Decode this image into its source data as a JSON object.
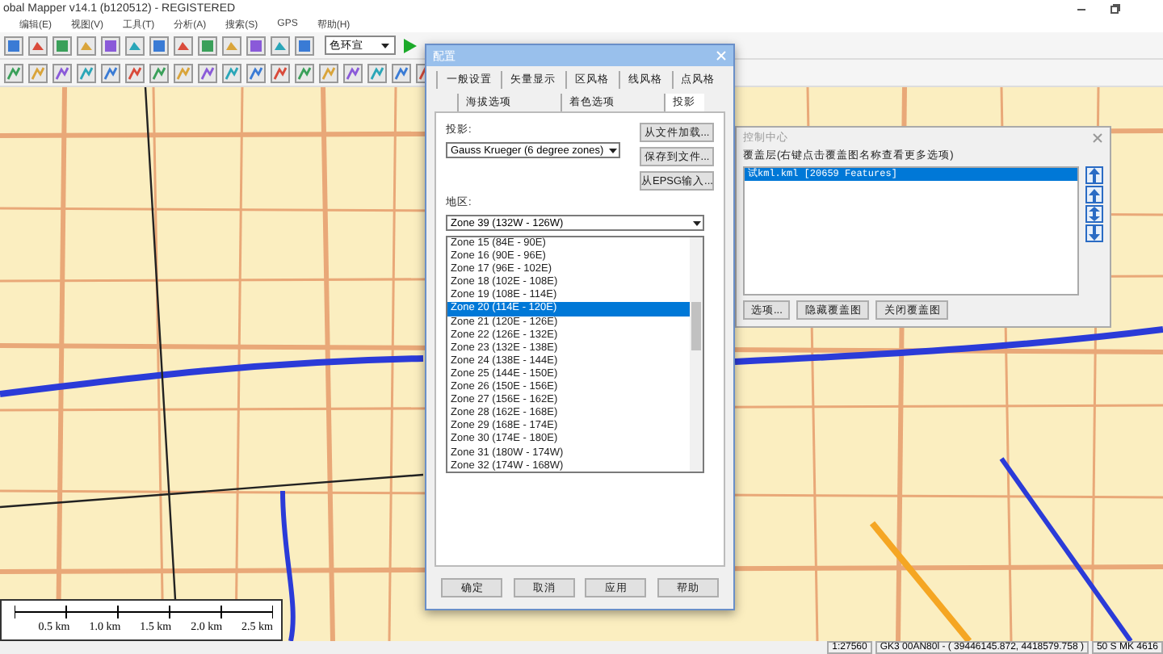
{
  "window": {
    "title": "obal Mapper v14.1 (b120512) - REGISTERED"
  },
  "menu": [
    "编辑(E)",
    "视图(V)",
    "工具(T)",
    "分析(A)",
    "搜索(S)",
    "GPS",
    "帮助(H)"
  ],
  "toolbar": {
    "combo": "色环宣"
  },
  "map": {
    "scale_labels": [
      "0.5 km",
      "1.0 km",
      "1.5 km",
      "2.0 km",
      "2.5 km"
    ]
  },
  "config_dialog": {
    "title": "配置",
    "tab_rows": [
      [
        {
          "label": "一般设置",
          "selected": false
        },
        {
          "label": "矢量显示",
          "selected": false
        },
        {
          "label": "区风格",
          "selected": false
        },
        {
          "label": "线风格",
          "selected": false
        },
        {
          "label": "点风格",
          "selected": false
        }
      ],
      [
        {
          "label": "海拔选项",
          "selected": false
        },
        {
          "label": "着色选项",
          "selected": false
        },
        {
          "label": "投影",
          "selected": true
        }
      ]
    ],
    "projection_label": "投影:",
    "projection": "Gauss Krueger (6 degree zones)",
    "side_buttons": [
      "从文件加载...",
      "保存到文件...",
      "从EPSG输入..."
    ],
    "zone_label": "地区:",
    "zone_value": "Zone 39 (132W - 126W)",
    "zone_options": [
      {
        "label": "Zone 15 (84E - 90E)",
        "selected": false
      },
      {
        "label": "Zone 16 (90E - 96E)",
        "selected": false
      },
      {
        "label": "Zone 17 (96E - 102E)",
        "selected": false
      },
      {
        "label": "Zone 18 (102E - 108E)",
        "selected": false
      },
      {
        "label": "Zone 19 (108E - 114E)",
        "selected": false
      },
      {
        "label": "Zone 20 (114E - 120E)",
        "selected": true
      },
      {
        "label": "Zone 21 (120E - 126E)",
        "selected": false
      },
      {
        "label": "Zone 22 (126E - 132E)",
        "selected": false
      },
      {
        "label": "Zone 23 (132E - 138E)",
        "selected": false
      },
      {
        "label": "Zone 24 (138E - 144E)",
        "selected": false
      },
      {
        "label": "Zone 25 (144E - 150E)",
        "selected": false
      },
      {
        "label": "Zone 26 (150E - 156E)",
        "selected": false
      },
      {
        "label": "Zone 27 (156E - 162E)",
        "selected": false
      },
      {
        "label": "Zone 28 (162E - 168E)",
        "selected": false
      },
      {
        "label": "Zone 29 (168E - 174E)",
        "selected": false
      },
      {
        "label": "Zone 30 (174E - 180E)",
        "selected": false
      },
      {
        "label": "Zone 31 (180W - 174W)",
        "selected": false
      },
      {
        "label": "Zone 32 (174W - 168W)",
        "selected": false
      }
    ],
    "footer_buttons": [
      "确定",
      "取消",
      "应用",
      "帮助"
    ]
  },
  "control_center": {
    "title": "控制中心",
    "hint": "覆盖层(右键点击覆盖图名称查看更多选项)",
    "layers": [
      {
        "label": "试kml.kml [20659 Features]",
        "selected": true
      }
    ],
    "buttons": [
      "选项...",
      "隐藏覆盖图",
      "关闭覆盖图"
    ]
  },
  "status_bar": {
    "fields": [
      "1:27560",
      "GK3 00AN80l - ( 39446145.872, 4418579.758 )",
      "50 S MK 4616"
    ]
  }
}
